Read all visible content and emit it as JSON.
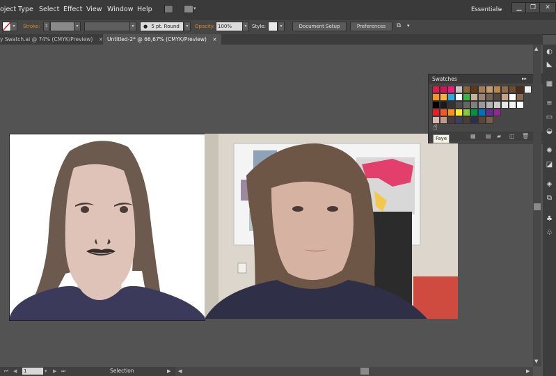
{
  "menu": {
    "items": [
      "oject",
      "Type",
      "Select",
      "Effect",
      "View",
      "Window",
      "Help"
    ],
    "workspace": "Essentials"
  },
  "control": {
    "stroke_label": "Stroke:",
    "brush_value": "5 pt. Round",
    "opacity_label": "Opacity:",
    "opacity_value": "100%",
    "style_label": "Style:",
    "document_setup": "Document Setup",
    "preferences": "Preferences"
  },
  "tabs": [
    {
      "label": "y Swatch.ai @ 74% (CMYK/Preview)",
      "active": false
    },
    {
      "label": "Untitled-2* @ 66,67% (CMYK/Preview)",
      "active": true
    }
  ],
  "swatches_panel": {
    "title": "Swatches",
    "tooltip": "Faye",
    "rows": [
      [
        "#e21b4d",
        "#d4145a",
        "#ed1e79",
        "#c5c5c5",
        "#8c6239",
        "#603813",
        "#a67c52",
        "#c69c6d",
        "#b8864f",
        "#8f6b4a",
        "#6e4b2e",
        "#4a2e1b",
        "#f0f0f0"
      ],
      [
        "#f7931e",
        "#fbb03b",
        "#29abe2",
        "#ffffff",
        "#39b54a",
        "#c7b299",
        "#998675",
        "#736357",
        "#534741",
        "#c4a484",
        "#ffffff",
        "#8a6a4f"
      ],
      [
        "#000000",
        "#1a1a1a",
        "#333333",
        "#4d4d4d",
        "#666666",
        "#808080",
        "#999999",
        "#b3b3b3",
        "#cccccc",
        "#e6e6e6",
        "#f2f2f2",
        "#ffffff"
      ],
      [
        "#ed1c24",
        "#f15a24",
        "#f7931e",
        "#fcee21",
        "#8cc63f",
        "#009245",
        "#0071bc",
        "#662d91",
        "#93278f"
      ],
      [
        "#d8b9ad",
        "#c29a88",
        "#4a3b36",
        "#3d3d5c",
        "#4e3b31",
        "#2e2e4a",
        "#5a4536",
        "#7c5d47"
      ]
    ]
  },
  "status": {
    "page": "1",
    "tool": "Selection"
  },
  "illustration": {
    "hair": "#6d5a4e",
    "skin": "#dfc3b8",
    "shirt": "#3b3a5a"
  }
}
